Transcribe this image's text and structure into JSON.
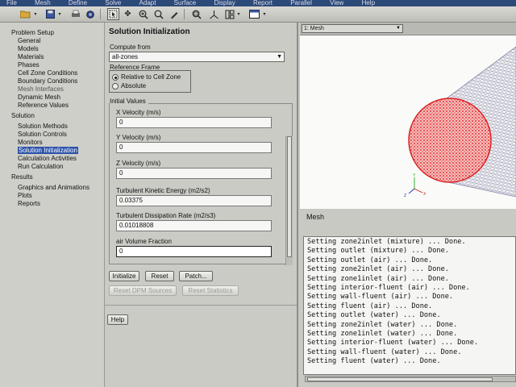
{
  "menubar": {
    "items": [
      "File",
      "Mesh",
      "Define",
      "Solve",
      "Adapt",
      "Surface",
      "Display",
      "Report",
      "Parallel",
      "View",
      "Help"
    ]
  },
  "toolbar": {
    "icons": [
      "open-folder-icon",
      "save-icon",
      "print-icon",
      "camera-icon",
      "pointer-icon",
      "move-icon",
      "zoom-in-icon",
      "zoom-icon",
      "rotate-icon",
      "probe-icon",
      "zoom-box-icon",
      "axes-icon",
      "layout-icon",
      "window-icon"
    ]
  },
  "tree": {
    "problem_setup": "Problem Setup",
    "ps_items": [
      "General",
      "Models",
      "Materials",
      "Phases",
      "Cell Zone Conditions",
      "Boundary Conditions",
      "Mesh Interfaces",
      "Dynamic Mesh",
      "Reference Values"
    ],
    "solution": "Solution",
    "sol_items": [
      "Solution Methods",
      "Solution Controls",
      "Monitors",
      "Solution Initialization",
      "Calculation Activities",
      "Run Calculation"
    ],
    "results": "Results",
    "res_items": [
      "Graphics and Animations",
      "Plots",
      "Reports"
    ]
  },
  "panel": {
    "title": "Solution Initialization",
    "compute_from_label": "Compute from",
    "compute_from_value": "all-zones",
    "reference_frame_label": "Reference Frame",
    "radio_relative": "Relative to Cell Zone",
    "radio_absolute": "Absolute",
    "initial_values_label": "Initial Values",
    "fields": [
      {
        "label": "X Velocity (m/s)",
        "value": "0"
      },
      {
        "label": "Y Velocity (m/s)",
        "value": "0"
      },
      {
        "label": "Z Velocity (m/s)",
        "value": "0"
      },
      {
        "label": "Turbulent Kinetic Energy (m2/s2)",
        "value": "0.03375"
      },
      {
        "label": "Turbulent Dissipation Rate (m2/s3)",
        "value": "0.01018808"
      },
      {
        "label": "air Volume Fraction",
        "value": "0"
      }
    ],
    "buttons": {
      "initialize": "Initialize",
      "reset": "Reset",
      "patch": "Patch...",
      "reset_dpm": "Reset DPM Sources",
      "reset_stats": "Reset Statistics",
      "help": "Help"
    }
  },
  "graphics": {
    "window_select": "1: Mesh",
    "caption": "Mesh",
    "mesh_color": "#e22222",
    "wire_color": "#8a8aa8"
  },
  "console": {
    "lines": [
      "Setting zone2inlet (mixture) ... Done.",
      "Setting outlet (mixture) ... Done.",
      "Setting outlet (air) ... Done.",
      "Setting zone2inlet (air) ... Done.",
      "Setting zone1inlet (air) ... Done.",
      "Setting interior-fluent (air) ... Done.",
      "Setting wall-fluent (air) ... Done.",
      "Setting fluent (air) ... Done.",
      "Setting outlet (water) ... Done.",
      "Setting zone2inlet (water) ... Done.",
      "Setting zone1inlet (water) ... Done.",
      "Setting interior-fluent (water) ... Done.",
      "Setting wall-fluent (water) ... Done.",
      "Setting fluent (water) ... Done."
    ]
  }
}
